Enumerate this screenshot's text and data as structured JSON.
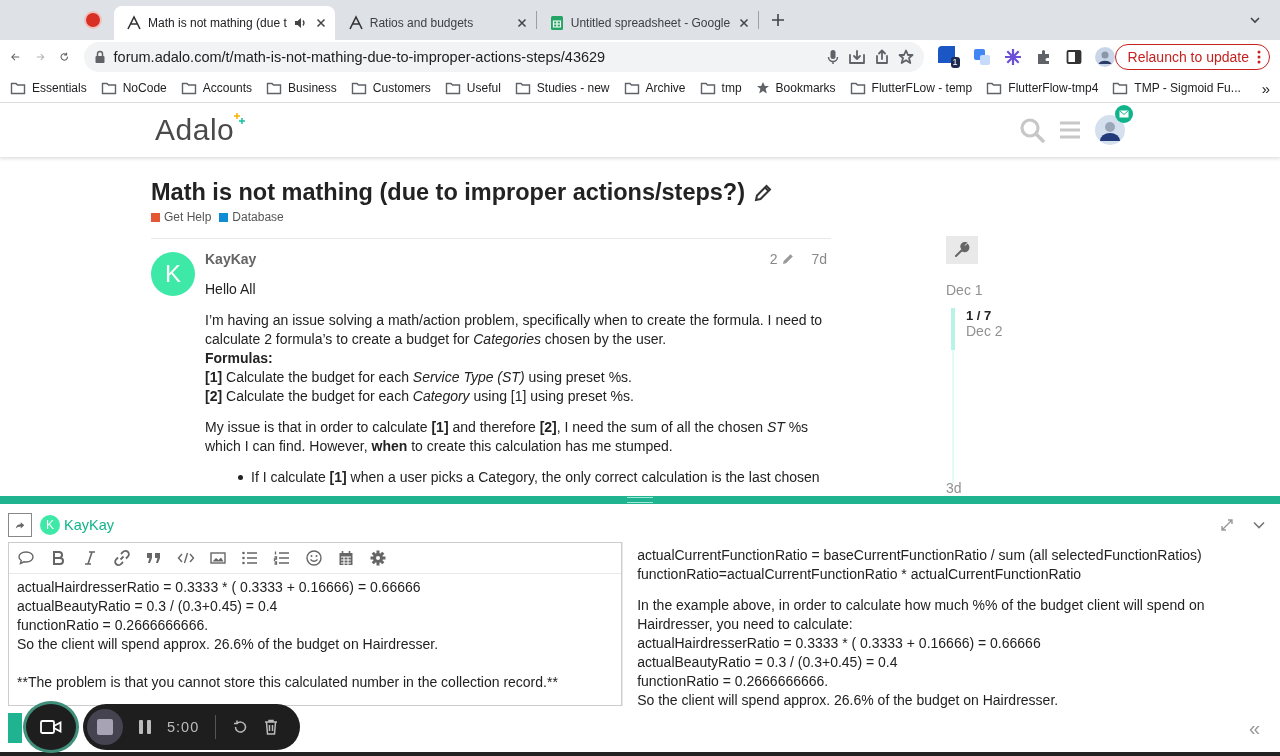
{
  "browser": {
    "recording": true,
    "tabs": [
      {
        "title": "Math is not mathing (due t",
        "selected": true,
        "kind": "adalo",
        "audio": true
      },
      {
        "title": "Ratios and budgets",
        "selected": false,
        "kind": "adalo",
        "audio": false
      },
      {
        "title": "Untitled spreadsheet - Google",
        "selected": false,
        "kind": "sheets",
        "audio": false
      }
    ],
    "url": "forum.adalo.com/t/math-is-not-mathing-due-to-improper-actions-steps/43629",
    "extension_badge": "1",
    "relaunch_button": "Relaunch to update",
    "bookmarks": [
      {
        "label": "Essentials",
        "kind": "folder"
      },
      {
        "label": "NoCode",
        "kind": "folder"
      },
      {
        "label": "Accounts",
        "kind": "folder"
      },
      {
        "label": "Business",
        "kind": "folder"
      },
      {
        "label": "Customers",
        "kind": "folder"
      },
      {
        "label": "Useful",
        "kind": "folder"
      },
      {
        "label": "Studies - new",
        "kind": "folder"
      },
      {
        "label": "Archive",
        "kind": "folder"
      },
      {
        "label": "tmp",
        "kind": "folder"
      },
      {
        "label": "Bookmarks",
        "kind": "star"
      },
      {
        "label": "FlutterFLow - temp",
        "kind": "folder"
      },
      {
        "label": "FlutterFlow-tmp4",
        "kind": "folder"
      },
      {
        "label": "TMP - Sigmoid Fu...",
        "kind": "folder"
      }
    ],
    "more_bookmarks": "»"
  },
  "site": {
    "logo": "Adalo"
  },
  "topic": {
    "title": "Math is not mathing (due to improper actions/steps?)",
    "categories": [
      {
        "name": "Get Help",
        "color": "#e45735"
      },
      {
        "name": "Database",
        "color": "#0e8dd4"
      }
    ]
  },
  "post": {
    "author": "KayKay",
    "avatar_letter": "K",
    "edits": "2",
    "age": "7d",
    "blocks": [
      {
        "kind": "paragraph",
        "lines": [
          {
            "text": "Hello All",
            "kind": "text"
          }
        ]
      },
      {
        "kind": "paragraph",
        "lines": [
          {
            "text": "I’m having an issue solving a math/action problem, specifically when to create the formula. I need to calculate 2 formula’s to create a budget for *Categories* chosen by the user.",
            "kind": "text"
          },
          {
            "text": "Formulas:",
            "kind": "label"
          },
          {
            "text": "**[1]** Calculate the budget for each *Service Type (ST)* using preset %s.",
            "kind": "text"
          },
          {
            "text": "**[2]** Calculate the budget for each *Category* using [1] using preset %s.",
            "kind": "text"
          }
        ]
      },
      {
        "kind": "paragraph",
        "lines": [
          {
            "text": "My issue is that in order to calculate **[1]** and therefore **[2]**, I need the sum of all the chosen *ST* %s which I can find. However, **when** to create this calculation has me stumped.",
            "kind": "text"
          }
        ]
      },
      {
        "kind": "bullet",
        "lines": [
          {
            "text": "If I calculate **[1]** when a user picks a Category, the only correct calculation is the last chosen",
            "kind": "text"
          }
        ]
      }
    ]
  },
  "timeline": {
    "start": "Dec 1",
    "position": "1 / 7",
    "position_date": "Dec 2",
    "end": "3d"
  },
  "composer": {
    "reply_to": "KayKay",
    "avatar_letter": "K",
    "editor_blocks": [
      [
        "actualHairdresserRatio = 0.3333 * ( 0.3333 + 0.16666) = 0.66666",
        "actualBeautyRatio = 0.3 / (0.3+0.45) = 0.4",
        "functionRatio = 0.2666666666.",
        "So the client will spend approx. 26.6% of the budget on Hairdresser."
      ],
      [
        "**The problem is that you cannot store this calculated number in the collection record.**"
      ]
    ],
    "preview_blocks": [
      [
        "actualCurrentFunctionRatio = baseCurrentFunctionRatio / sum (all selectedFunctionRatios)",
        "functionRatio=actualCurrentFunctionRatio * actualCurrentFunctionRatio"
      ],
      [
        "In the example above, in order to calculate how much %% of the budget client will spend on Hairdresser, you need to calculate:",
        "actualHairdresserRatio = 0.3333 * ( 0.3333 + 0.16666) = 0.66666",
        "actualBeautyRatio = 0.3 / (0.3+0.45) = 0.4",
        "functionRatio = 0.2666666666.",
        "So the client will spend approx. 26.6% of the budget on Hairdresser."
      ]
    ],
    "collapse_button": "«"
  },
  "recorder": {
    "timer": "5:00"
  }
}
